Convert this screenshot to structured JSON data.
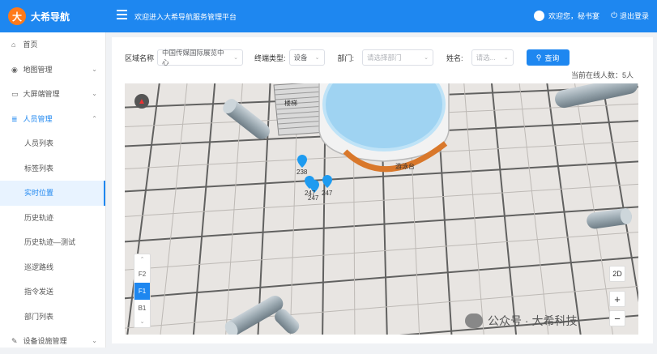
{
  "header": {
    "logo_char": "大",
    "app_name": "大希导航",
    "welcome": "欢迎进入大希导航服务管理平台",
    "user_greeting": "欢迎您，秘书宴",
    "logout_label": "退出登录",
    "brand_color": "#1e87f0"
  },
  "sidebar": {
    "items": [
      {
        "label": "首页",
        "icon": "home-icon",
        "chevron": ""
      },
      {
        "label": "地图管理",
        "icon": "map-icon",
        "chevron": "⌄"
      },
      {
        "label": "大屏端管理",
        "icon": "monitor-icon",
        "chevron": "⌄"
      },
      {
        "label": "人员管理",
        "icon": "people-icon",
        "chevron": "⌃"
      },
      {
        "label": "人员列表",
        "icon": "",
        "chevron": ""
      },
      {
        "label": "标签列表",
        "icon": "",
        "chevron": ""
      },
      {
        "label": "实时位置",
        "icon": "",
        "chevron": ""
      },
      {
        "label": "历史轨迹",
        "icon": "",
        "chevron": ""
      },
      {
        "label": "历史轨迹—测试",
        "icon": "",
        "chevron": ""
      },
      {
        "label": "巡逻路线",
        "icon": "",
        "chevron": ""
      },
      {
        "label": "指令发送",
        "icon": "",
        "chevron": ""
      },
      {
        "label": "部门列表",
        "icon": "",
        "chevron": ""
      },
      {
        "label": "设备设施管理",
        "icon": "wrench-icon",
        "chevron": "⌄"
      }
    ]
  },
  "filters": {
    "area_label": "区域名称",
    "area_value": "中国传媒国际展览中心",
    "type_label": "终端类型:",
    "type_value": "设备",
    "dept_label": "部门:",
    "dept_placeholder": "请选择部门",
    "name_label": "姓名:",
    "name_placeholder": "请选...",
    "query_label": "查询"
  },
  "online_count_text": "当前在线人数：5人",
  "map": {
    "compass_glyph": "▲",
    "stairs_label": "楼梯",
    "pool_label": "游泳台",
    "pins": [
      {
        "label": "238"
      },
      {
        "label": "247"
      },
      {
        "label": "247"
      },
      {
        "label": "247"
      }
    ],
    "floors": [
      "F2",
      "F1",
      "B1"
    ],
    "active_floor": "F1",
    "view_2d": "2D",
    "zoom_in": "+",
    "zoom_out": "−"
  },
  "watermark": "公众号 · 大希科技"
}
